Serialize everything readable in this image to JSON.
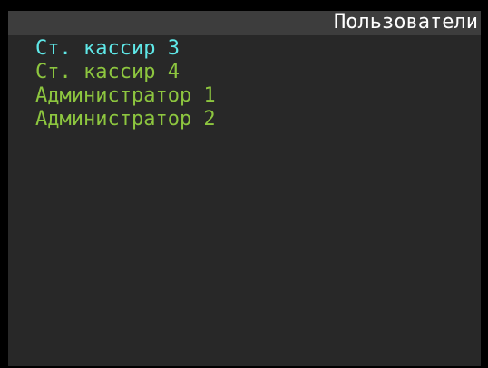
{
  "header": {
    "title": "Пользователи"
  },
  "users": [
    {
      "label": "Ст. кассир 3",
      "selected": true
    },
    {
      "label": "Ст. кассир 4",
      "selected": false
    },
    {
      "label": "Администратор 1",
      "selected": false
    },
    {
      "label": "Администратор 2",
      "selected": false
    }
  ],
  "colors": {
    "background": "#000000",
    "panel": "#282828",
    "title_bar": "#3d3d3d",
    "title_text": "#ffffff",
    "item_normal": "#8dc63f",
    "item_selected": "#5fe8e8"
  }
}
